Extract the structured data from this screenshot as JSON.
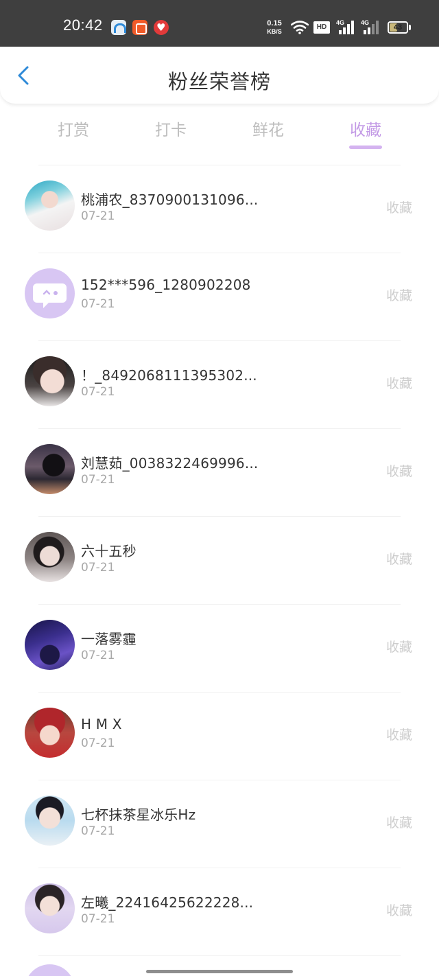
{
  "status_bar": {
    "time": "20:42",
    "net_speed_value": "0.15",
    "net_speed_unit": "KB/S",
    "hd_label": "HD",
    "signal1_label": "4G",
    "signal2_label": "4G",
    "battery_level": "43"
  },
  "header": {
    "title": "粉丝荣誉榜",
    "back_icon": "chevron-left-icon"
  },
  "tabs": [
    {
      "label": "打赏",
      "active": false
    },
    {
      "label": "打卡",
      "active": false
    },
    {
      "label": "鲜花",
      "active": false
    },
    {
      "label": "收藏",
      "active": true
    }
  ],
  "fans": [
    {
      "name": "桃浦农_8370900131096...",
      "date": "07-21",
      "action": "收藏"
    },
    {
      "name": "152***596_1280902208",
      "date": "07-21",
      "action": "收藏"
    },
    {
      "name": "！_8492068111395302...",
      "date": "07-21",
      "action": "收藏"
    },
    {
      "name": "刘慧茹_0038322469996...",
      "date": "07-21",
      "action": "收藏"
    },
    {
      "name": "六十五秒",
      "date": "07-21",
      "action": "收藏"
    },
    {
      "name": "一落雾霾",
      "date": "07-21",
      "action": "收藏"
    },
    {
      "name": "H M X",
      "date": "07-21",
      "action": "收藏"
    },
    {
      "name": "七杯抹茶星冰乐Hz",
      "date": "07-21",
      "action": "收藏"
    },
    {
      "name": "左曦_22416425622228...",
      "date": "07-21",
      "action": "收藏"
    }
  ],
  "colors": {
    "accent": "#c39ae6",
    "tab_inactive": "#bdbdbd",
    "back_icon": "#2e8ad8",
    "status_bar_bg": "#3f3f3f"
  }
}
